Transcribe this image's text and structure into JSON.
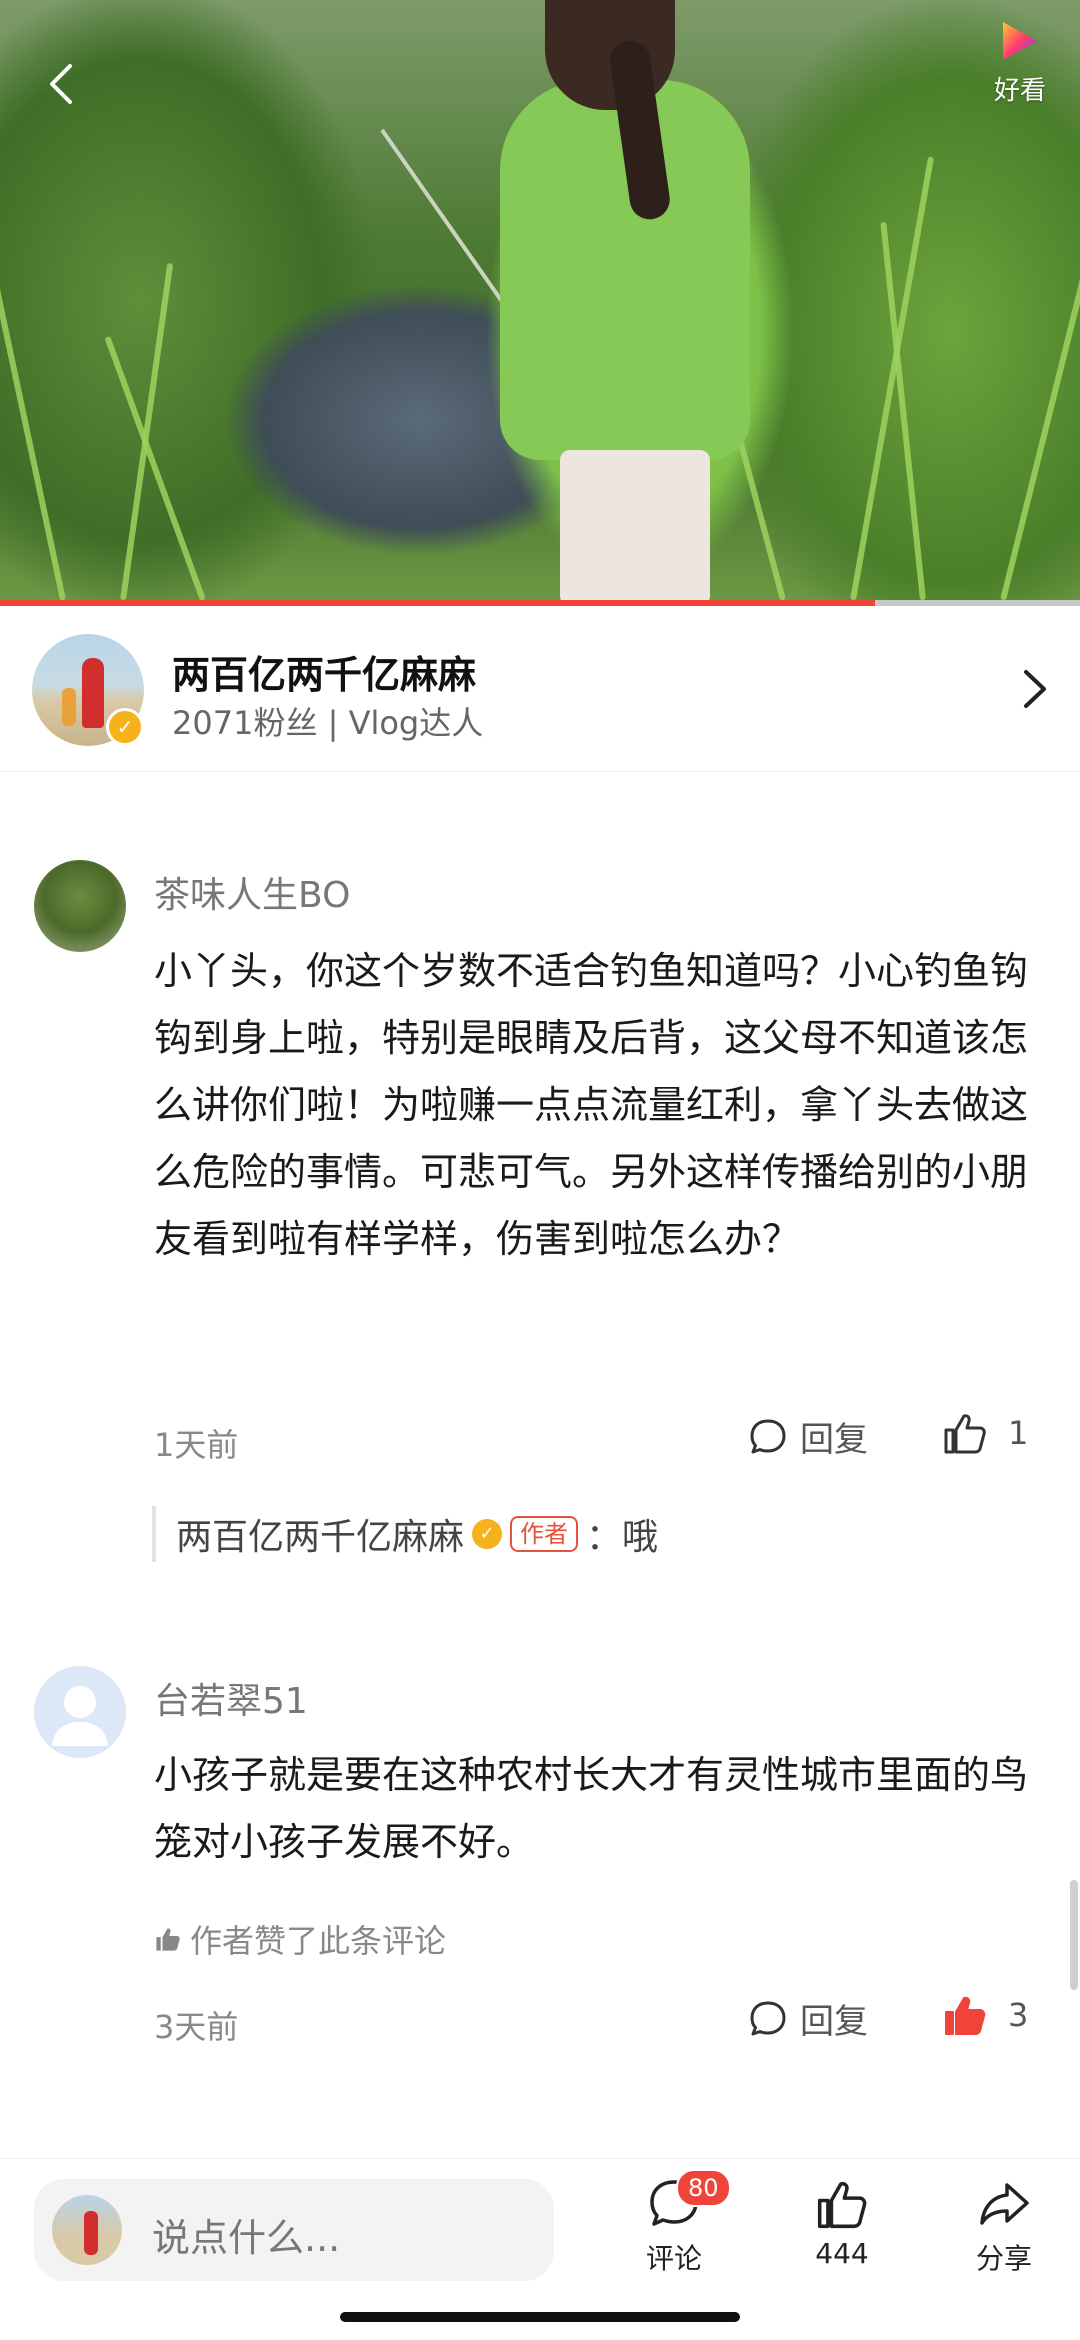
{
  "header": {
    "brand_name": "好看",
    "progress_fraction": 0.81
  },
  "author": {
    "name": "两百亿两千亿麻麻",
    "meta": "2071粉丝 | Vlog达人"
  },
  "comments": [
    {
      "user": "茶味人生BO",
      "text": "小丫头，你这个岁数不适合钓鱼知道吗？小心钓鱼钩钩到身上啦，特别是眼睛及后背，这父母不知道该怎么讲你们啦！为啦赚一点点流量红利，拿丫头去做这么危险的事情。可悲可气。另外这样传播给别的小朋友看到啦有样学样，伤害到啦怎么办？",
      "time": "1天前",
      "reply_label": "回复",
      "likes": "1",
      "author_reply": {
        "name": "两百亿两千亿麻麻",
        "tag": "作者",
        "text": "：哦"
      }
    },
    {
      "user": "台若翠51",
      "text": "小孩子就是要在这种农村长大才有灵性城市里面的鸟笼对小孩子发展不好。",
      "liked_note": "作者赞了此条评论",
      "time": "3天前",
      "reply_label": "回复",
      "likes": "3"
    }
  ],
  "bottom": {
    "input_placeholder": "说点什么...",
    "comment_label": "评论",
    "comment_badge": "80",
    "like_count": "444",
    "share_label": "分享"
  },
  "colors": {
    "accent": "#f0443b",
    "verified": "#f5b21b"
  },
  "icons": [
    "back-arrow-icon",
    "haokan-logo-icon",
    "verified-icon",
    "chevron-right-icon",
    "reply-bubble-icon",
    "thumbs-up-icon",
    "share-arrow-icon"
  ]
}
